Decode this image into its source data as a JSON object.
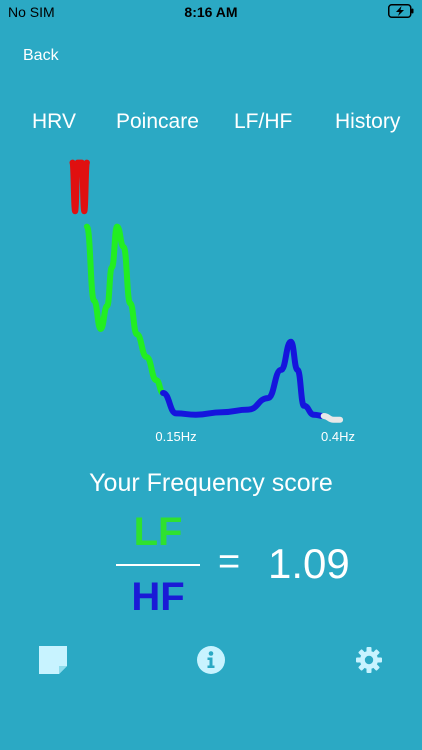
{
  "status_bar": {
    "carrier": "No SIM",
    "time": "8:16 AM",
    "battery_icon": "battery-charging-icon"
  },
  "nav": {
    "back_label": "Back"
  },
  "tabs": [
    {
      "label": "HRV"
    },
    {
      "label": "Poincare"
    },
    {
      "label": "LF/HF"
    },
    {
      "label": "History"
    }
  ],
  "chart": {
    "tick_labels": [
      "0.15Hz",
      "0.4Hz"
    ],
    "colors": {
      "vlf": "#e01010",
      "lf": "#22ee22",
      "hf": "#1515dd",
      "tail": "#e8e8e8"
    }
  },
  "chart_data": {
    "type": "line",
    "title": "",
    "xlabel": "",
    "ylabel": "",
    "x_ticks": [
      "0.15Hz",
      "0.4Hz"
    ],
    "series": [
      {
        "color": "#e01010",
        "x": [
          0.012,
          0.016,
          0.02,
          0.026,
          0.03,
          0.034
        ],
        "y": [
          0.99,
          0.8,
          0.99,
          0.99,
          0.8,
          0.99
        ]
      },
      {
        "color": "#22ee22",
        "x": [
          0.034,
          0.045,
          0.055,
          0.065,
          0.072,
          0.08,
          0.09,
          0.1,
          0.11,
          0.125,
          0.14,
          0.15
        ],
        "y": [
          0.74,
          0.45,
          0.34,
          0.43,
          0.58,
          0.74,
          0.66,
          0.44,
          0.32,
          0.23,
          0.14,
          0.09
        ]
      },
      {
        "color": "#1515dd",
        "x": [
          0.15,
          0.17,
          0.2,
          0.24,
          0.28,
          0.31,
          0.33,
          0.345,
          0.355,
          0.365,
          0.38,
          0.395
        ],
        "y": [
          0.09,
          0.01,
          0.005,
          0.015,
          0.025,
          0.07,
          0.18,
          0.29,
          0.18,
          0.04,
          0.005,
          0.0
        ]
      },
      {
        "color": "#e8e8e8",
        "x": [
          0.395,
          0.41,
          0.42
        ],
        "y": [
          0.0,
          -0.015,
          -0.015
        ]
      }
    ]
  },
  "score": {
    "title": "Your Frequency score",
    "numerator": "LF",
    "denominator": "HF",
    "equals": "=",
    "value": "1.09",
    "numerator_color": "#2fe12f",
    "denominator_color": "#1a1ad6"
  },
  "toolbar": {
    "notes_icon": "note-icon",
    "info_icon": "info-icon",
    "settings_icon": "gear-icon"
  },
  "background": "#2ba9c4"
}
